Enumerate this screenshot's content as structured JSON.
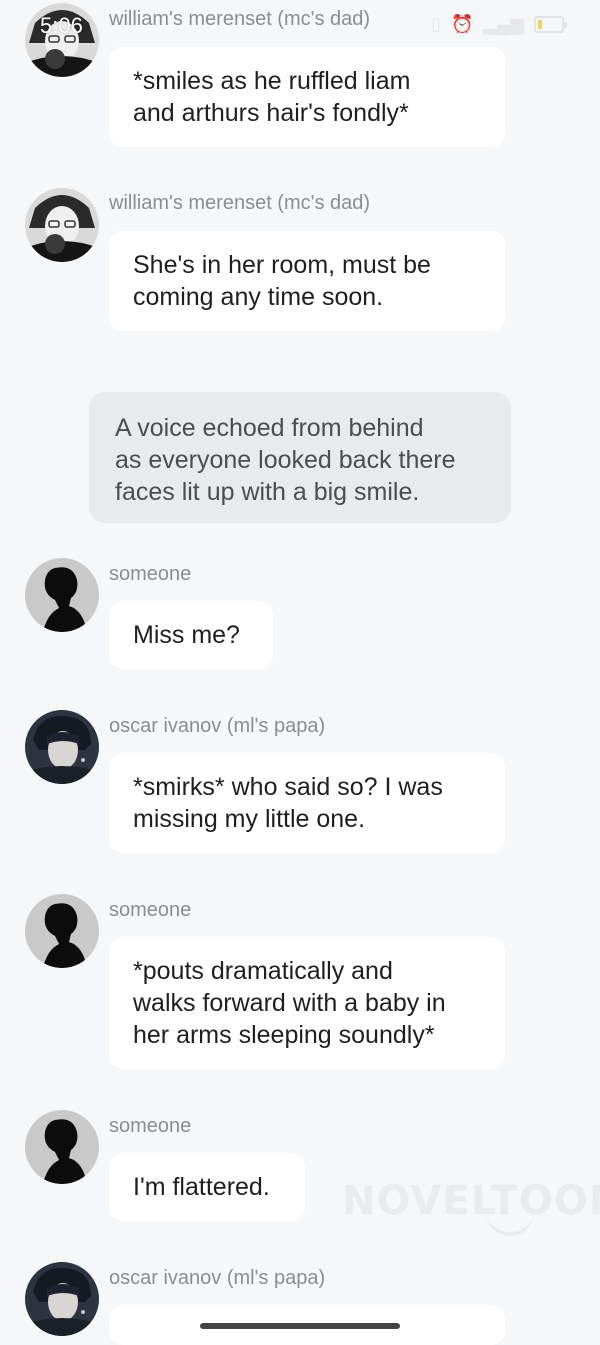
{
  "status_bar": {
    "time": "5:06",
    "icons": [
      "vibrate-icon",
      "alarm-icon",
      "signal-icon",
      "battery-icon"
    ]
  },
  "messages": [
    {
      "speaker": "william's merenset (mc's dad)",
      "avatar": "william-avatar",
      "text_lines": [
        "*smiles as he ruffled liam",
        "and arthurs hair's fondly*"
      ]
    },
    {
      "speaker": "william's merenset (mc's dad)",
      "avatar": "william-avatar",
      "text_lines": [
        "She's in her room, must be",
        "coming any time soon."
      ]
    },
    {
      "narration_lines": [
        "A voice echoed from behind",
        "as everyone looked back there",
        "faces lit up with a big smile."
      ]
    },
    {
      "speaker": "someone",
      "avatar": "silhouette-avatar",
      "text_lines": [
        "Miss me?"
      ]
    },
    {
      "speaker": "oscar ivanov (ml's papa)",
      "avatar": "oscar-avatar",
      "text_lines": [
        "*smirks* who said so? I was",
        "missing my little one."
      ]
    },
    {
      "speaker": "someone",
      "avatar": "silhouette-avatar",
      "text_lines": [
        "*pouts dramatically and",
        "walks forward with a baby in",
        "her arms sleeping soundly*"
      ]
    },
    {
      "speaker": "someone",
      "avatar": "silhouette-avatar",
      "text_lines": [
        "I'm flattered."
      ]
    },
    {
      "speaker": "oscar ivanov (ml's papa)",
      "avatar": "oscar-avatar",
      "text_lines": [
        ""
      ]
    }
  ],
  "watermark": "NOVELTOON",
  "colors": {
    "background": "#f6f7f9",
    "bubble": "#ffffff",
    "narration": "#e9eaec",
    "name": "#8a8d92"
  }
}
